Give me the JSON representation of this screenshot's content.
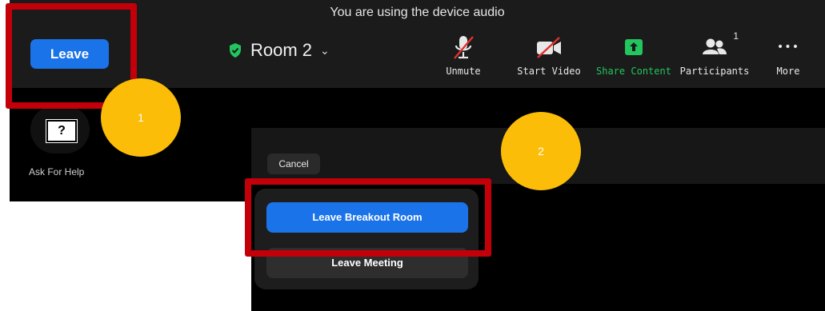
{
  "banner": {
    "text": "You are using the device audio"
  },
  "leave_button": {
    "label": "Leave"
  },
  "room": {
    "name": "Room 2",
    "dropdown_glyph": "⌄"
  },
  "toolbar": {
    "unmute": {
      "label": "Unmute",
      "icon": "mic-muted-icon"
    },
    "start_video": {
      "label": "Start Video",
      "icon": "video-off-icon"
    },
    "share_content": {
      "label": "Share Content",
      "icon": "share-up-arrow-icon",
      "color": "#22c55e"
    },
    "participants": {
      "label": "Participants",
      "count": "1",
      "icon": "people-icon"
    },
    "more": {
      "label": "More",
      "glyph": "•••"
    }
  },
  "help": {
    "icon_text": "?",
    "label": "Ask For Help"
  },
  "cancel_button": {
    "label": "Cancel"
  },
  "popup": {
    "leave_breakout_label": "Leave Breakout Room",
    "leave_meeting_label": "Leave Meeting"
  },
  "annotations": {
    "marker_1": "1",
    "marker_2": "2"
  },
  "colors": {
    "accent_blue": "#1a73e8",
    "highlight_red": "#c3000a",
    "marker_yellow": "#fbbd08"
  }
}
